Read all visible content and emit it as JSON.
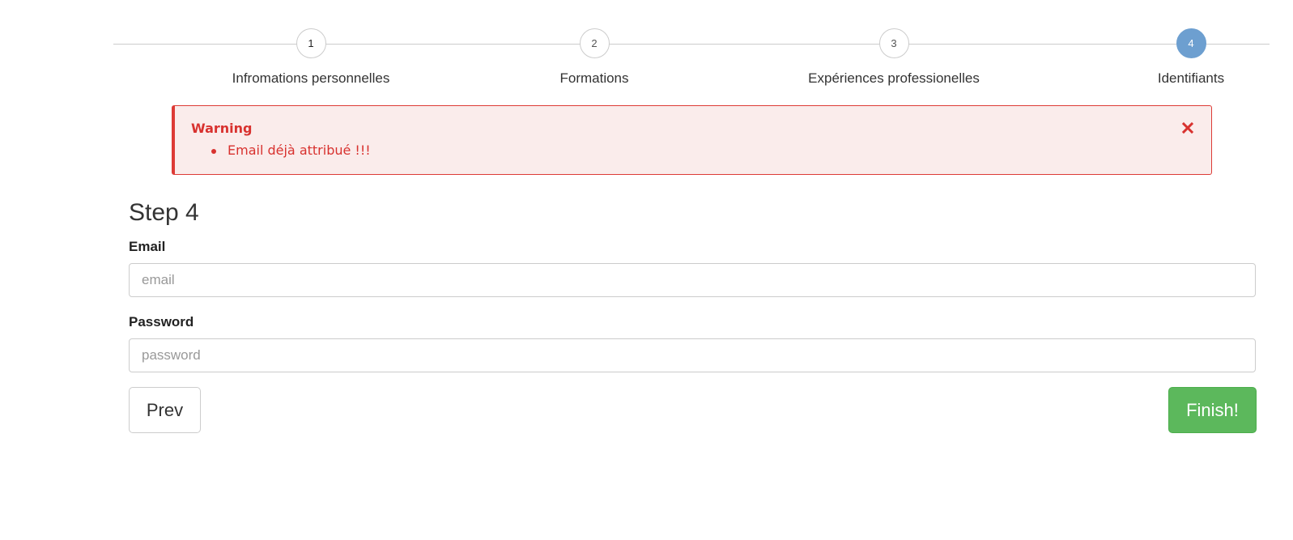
{
  "stepper": {
    "steps": [
      {
        "number": "1",
        "label": "Infromations personnelles",
        "state": "done"
      },
      {
        "number": "2",
        "label": "Formations",
        "state": "done"
      },
      {
        "number": "3",
        "label": "Expériences professionelles",
        "state": "done"
      },
      {
        "number": "4",
        "label": "Identifiants",
        "state": "active"
      }
    ],
    "active_color": "#6d9fd0"
  },
  "alert": {
    "title": "Warning",
    "items": [
      "Email déjà attribué !!!"
    ],
    "close_icon": "close-icon",
    "color": "#d8322f",
    "background": "#faeceb"
  },
  "form": {
    "title": "Step 4",
    "email": {
      "label": "Email",
      "value": "",
      "placeholder": "email"
    },
    "password": {
      "label": "Password",
      "value": "",
      "placeholder": "password"
    },
    "prev_label": "Prev",
    "finish_label": "Finish!",
    "finish_color": "#5cb85c"
  }
}
